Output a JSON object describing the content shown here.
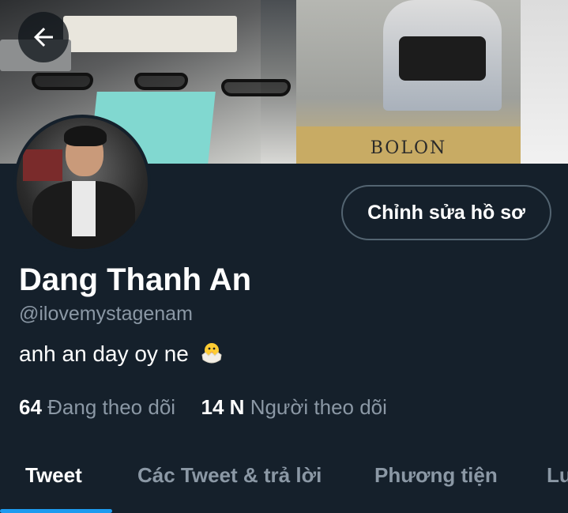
{
  "header": {
    "back_icon": "arrow-left-icon"
  },
  "banner": {
    "brand_sign": "BOLON"
  },
  "profile": {
    "display_name": "Dang Thanh An",
    "handle": "@ilovemystagenam",
    "bio": "anh an day oy ne",
    "bio_emoji": "hatching-chick-icon",
    "edit_button_label": "Chỉnh sửa hồ sơ",
    "following_count": "64",
    "following_label": "Đang theo dõi",
    "followers_count": "14 N",
    "followers_label": "Người theo dõi"
  },
  "tabs": [
    {
      "label": "Tweet",
      "active": true
    },
    {
      "label": "Các Tweet & trả lời",
      "active": false
    },
    {
      "label": "Phương tiện",
      "active": false
    },
    {
      "label": "Lư",
      "active": false
    }
  ],
  "colors": {
    "background": "#15202b",
    "accent": "#1d9bf0",
    "secondary_text": "#8b98a5",
    "border": "#536471"
  }
}
